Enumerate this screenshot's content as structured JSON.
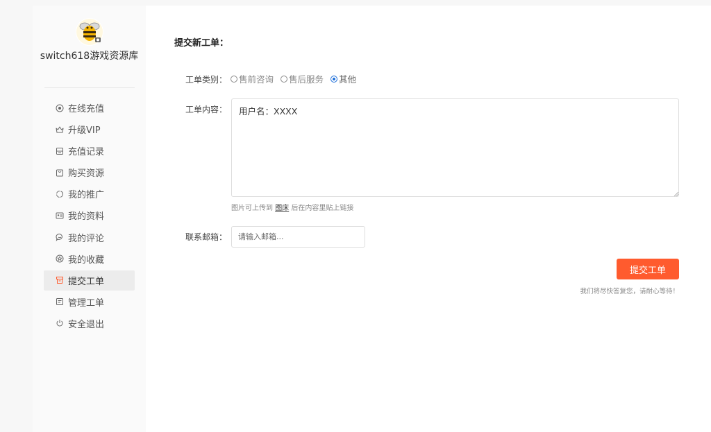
{
  "sidebar": {
    "site_name": "switch618游戏资源库",
    "items": [
      {
        "label": "在线充值",
        "icon": "coin-icon"
      },
      {
        "label": "升级VIP",
        "icon": "crown-icon"
      },
      {
        "label": "充值记录",
        "icon": "record-icon"
      },
      {
        "label": "购买资源",
        "icon": "bag-icon"
      },
      {
        "label": "我的推广",
        "icon": "share-icon"
      },
      {
        "label": "我的资料",
        "icon": "profile-card-icon"
      },
      {
        "label": "我的评论",
        "icon": "comment-icon"
      },
      {
        "label": "我的收藏",
        "icon": "star-icon"
      },
      {
        "label": "提交工单",
        "icon": "ticket-icon",
        "active": true
      },
      {
        "label": "管理工单",
        "icon": "list-icon"
      },
      {
        "label": "安全退出",
        "icon": "power-icon"
      }
    ]
  },
  "main": {
    "title": "提交新工单：",
    "category_label": "工单类别：",
    "category_options": [
      {
        "label": "售前咨询",
        "checked": false
      },
      {
        "label": "售后服务",
        "checked": false
      },
      {
        "label": "其他",
        "checked": true
      }
    ],
    "content_label": "工单内容：",
    "content_value": "用户名：XXXX",
    "hint_prefix": "图片可上传到",
    "hint_link": "图床",
    "hint_suffix": "后在内容里贴上链接",
    "email_label": "联系邮箱：",
    "email_placeholder": "请输入邮箱...",
    "submit_label": "提交工单",
    "reply_note": "我们将尽快答复您，请耐心等待！"
  },
  "colors": {
    "accent": "#ff5b2e",
    "radio_checked": "#1e6fd9"
  }
}
